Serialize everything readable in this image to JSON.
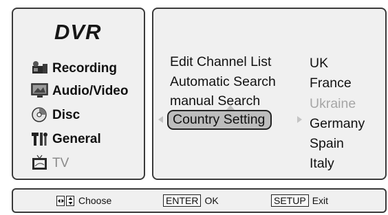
{
  "left_menu": {
    "title": "DVR",
    "items": [
      {
        "label": "Recording",
        "icon": "camera-icon",
        "state": "normal"
      },
      {
        "label": "Audio/Video",
        "icon": "monitor-icon",
        "state": "normal"
      },
      {
        "label": "Disc",
        "icon": "disc-icon",
        "state": "normal"
      },
      {
        "label": "General",
        "icon": "tools-icon",
        "state": "normal"
      },
      {
        "label": "TV",
        "icon": "tv-icon",
        "state": "disabled"
      }
    ]
  },
  "submenu": {
    "items": [
      {
        "label": "Edit Channel List"
      },
      {
        "label": "Automatic Search"
      },
      {
        "label": "manual Search"
      },
      {
        "label": "Country Setting",
        "selected": true
      }
    ]
  },
  "countries": [
    {
      "label": "UK",
      "state": "normal"
    },
    {
      "label": "France",
      "state": "normal"
    },
    {
      "label": "Ukraine",
      "state": "disabled"
    },
    {
      "label": "Germany",
      "state": "normal"
    },
    {
      "label": "Spain",
      "state": "normal"
    },
    {
      "label": "Italy",
      "state": "normal"
    }
  ],
  "footer": {
    "choose_label": "Choose",
    "enter_key": "ENTER",
    "enter_label": "OK",
    "setup_key": "SETUP",
    "setup_label": "Exit"
  },
  "colors": {
    "panel_bg": "#f0f0f0",
    "border": "#3a3a3a",
    "selected_bg": "#bdbdbd",
    "disabled_text": "#a6a6a6"
  }
}
